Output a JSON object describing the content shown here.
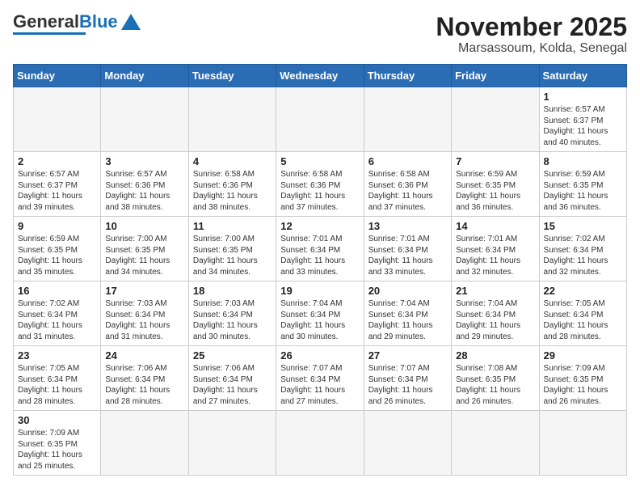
{
  "logo": {
    "part1": "General",
    "part2": "Blue"
  },
  "title": "November 2025",
  "subtitle": "Marsassoum, Kolda, Senegal",
  "days_of_week": [
    "Sunday",
    "Monday",
    "Tuesday",
    "Wednesday",
    "Thursday",
    "Friday",
    "Saturday"
  ],
  "weeks": [
    [
      {
        "day": "",
        "info": ""
      },
      {
        "day": "",
        "info": ""
      },
      {
        "day": "",
        "info": ""
      },
      {
        "day": "",
        "info": ""
      },
      {
        "day": "",
        "info": ""
      },
      {
        "day": "",
        "info": ""
      },
      {
        "day": "1",
        "info": "Sunrise: 6:57 AM\nSunset: 6:37 PM\nDaylight: 11 hours\nand 40 minutes."
      }
    ],
    [
      {
        "day": "2",
        "info": "Sunrise: 6:57 AM\nSunset: 6:37 PM\nDaylight: 11 hours\nand 39 minutes."
      },
      {
        "day": "3",
        "info": "Sunrise: 6:57 AM\nSunset: 6:36 PM\nDaylight: 11 hours\nand 38 minutes."
      },
      {
        "day": "4",
        "info": "Sunrise: 6:58 AM\nSunset: 6:36 PM\nDaylight: 11 hours\nand 38 minutes."
      },
      {
        "day": "5",
        "info": "Sunrise: 6:58 AM\nSunset: 6:36 PM\nDaylight: 11 hours\nand 37 minutes."
      },
      {
        "day": "6",
        "info": "Sunrise: 6:58 AM\nSunset: 6:36 PM\nDaylight: 11 hours\nand 37 minutes."
      },
      {
        "day": "7",
        "info": "Sunrise: 6:59 AM\nSunset: 6:35 PM\nDaylight: 11 hours\nand 36 minutes."
      },
      {
        "day": "8",
        "info": "Sunrise: 6:59 AM\nSunset: 6:35 PM\nDaylight: 11 hours\nand 36 minutes."
      }
    ],
    [
      {
        "day": "9",
        "info": "Sunrise: 6:59 AM\nSunset: 6:35 PM\nDaylight: 11 hours\nand 35 minutes."
      },
      {
        "day": "10",
        "info": "Sunrise: 7:00 AM\nSunset: 6:35 PM\nDaylight: 11 hours\nand 34 minutes."
      },
      {
        "day": "11",
        "info": "Sunrise: 7:00 AM\nSunset: 6:35 PM\nDaylight: 11 hours\nand 34 minutes."
      },
      {
        "day": "12",
        "info": "Sunrise: 7:01 AM\nSunset: 6:34 PM\nDaylight: 11 hours\nand 33 minutes."
      },
      {
        "day": "13",
        "info": "Sunrise: 7:01 AM\nSunset: 6:34 PM\nDaylight: 11 hours\nand 33 minutes."
      },
      {
        "day": "14",
        "info": "Sunrise: 7:01 AM\nSunset: 6:34 PM\nDaylight: 11 hours\nand 32 minutes."
      },
      {
        "day": "15",
        "info": "Sunrise: 7:02 AM\nSunset: 6:34 PM\nDaylight: 11 hours\nand 32 minutes."
      }
    ],
    [
      {
        "day": "16",
        "info": "Sunrise: 7:02 AM\nSunset: 6:34 PM\nDaylight: 11 hours\nand 31 minutes."
      },
      {
        "day": "17",
        "info": "Sunrise: 7:03 AM\nSunset: 6:34 PM\nDaylight: 11 hours\nand 31 minutes."
      },
      {
        "day": "18",
        "info": "Sunrise: 7:03 AM\nSunset: 6:34 PM\nDaylight: 11 hours\nand 30 minutes."
      },
      {
        "day": "19",
        "info": "Sunrise: 7:04 AM\nSunset: 6:34 PM\nDaylight: 11 hours\nand 30 minutes."
      },
      {
        "day": "20",
        "info": "Sunrise: 7:04 AM\nSunset: 6:34 PM\nDaylight: 11 hours\nand 29 minutes."
      },
      {
        "day": "21",
        "info": "Sunrise: 7:04 AM\nSunset: 6:34 PM\nDaylight: 11 hours\nand 29 minutes."
      },
      {
        "day": "22",
        "info": "Sunrise: 7:05 AM\nSunset: 6:34 PM\nDaylight: 11 hours\nand 28 minutes."
      }
    ],
    [
      {
        "day": "23",
        "info": "Sunrise: 7:05 AM\nSunset: 6:34 PM\nDaylight: 11 hours\nand 28 minutes."
      },
      {
        "day": "24",
        "info": "Sunrise: 7:06 AM\nSunset: 6:34 PM\nDaylight: 11 hours\nand 28 minutes."
      },
      {
        "day": "25",
        "info": "Sunrise: 7:06 AM\nSunset: 6:34 PM\nDaylight: 11 hours\nand 27 minutes."
      },
      {
        "day": "26",
        "info": "Sunrise: 7:07 AM\nSunset: 6:34 PM\nDaylight: 11 hours\nand 27 minutes."
      },
      {
        "day": "27",
        "info": "Sunrise: 7:07 AM\nSunset: 6:34 PM\nDaylight: 11 hours\nand 26 minutes."
      },
      {
        "day": "28",
        "info": "Sunrise: 7:08 AM\nSunset: 6:35 PM\nDaylight: 11 hours\nand 26 minutes."
      },
      {
        "day": "29",
        "info": "Sunrise: 7:09 AM\nSunset: 6:35 PM\nDaylight: 11 hours\nand 26 minutes."
      }
    ],
    [
      {
        "day": "30",
        "info": "Sunrise: 7:09 AM\nSunset: 6:35 PM\nDaylight: 11 hours\nand 25 minutes."
      },
      {
        "day": "",
        "info": ""
      },
      {
        "day": "",
        "info": ""
      },
      {
        "day": "",
        "info": ""
      },
      {
        "day": "",
        "info": ""
      },
      {
        "day": "",
        "info": ""
      },
      {
        "day": "",
        "info": ""
      }
    ]
  ]
}
